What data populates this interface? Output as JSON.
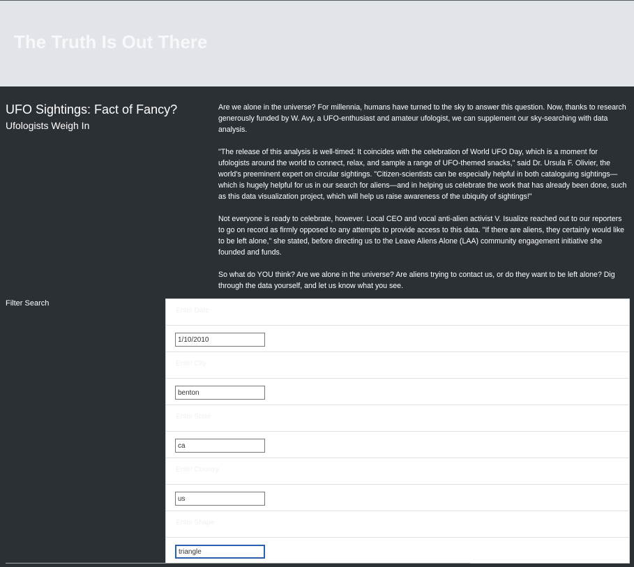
{
  "header": {
    "title": "The Truth Is Out There"
  },
  "intro": {
    "title": "UFO Sightings: Fact of Fancy?",
    "subtitle": "Ufologists Weigh In"
  },
  "article": {
    "paragraphs": [
      "Are we alone in the universe? For millennia, humans have turned to the sky to answer this question. Now, thanks to research generously funded by W. Avy, a UFO-enthusiast and amateur ufologist, we can supplement our sky-searching with data analysis.",
      "\"The release of this analysis is well-timed: It coincides with the celebration of World UFO Day, which is a moment for ufologists around the world to connect, relax, and sample a range of UFO-themed snacks,\" said Dr. Ursula F. Olivier, the world's preeminent expert on circular sightings. \"Citizen-scientists can be especially helpful in both cataloguing sightings—which is hugely helpful for us in our search for aliens—and in helping us celebrate the work that has already been done, such as this data visualization project, which will help us raise awareness of the ubiquity of sightings!\"",
      "Not everyone is ready to celebrate, however. Local CEO and vocal anti-alien activist V. Isualize reached out to our reporters to go on record as firmly opposed to any attempts to provide access to this data. \"If there are aliens, they certainly would like to be left alone,\" she stated, before directing us to the Leave Aliens Alone (LAA) community engagement initiative she founded and funds.",
      "So what do YOU think? Are we alone in the universe? Are aliens trying to contact us, or do they want to be left alone? Dig through the data yourself, and let us know what you see."
    ]
  },
  "filters": {
    "label": "Filter Search",
    "date": {
      "label": "Enter Date",
      "value": "1/10/2010"
    },
    "city": {
      "label": "Enter City",
      "value": "benton"
    },
    "state": {
      "label": "Enter State",
      "value": "ca"
    },
    "country": {
      "label": "Enter Country",
      "value": "us"
    },
    "shape": {
      "label": "Enter Shape",
      "value": "triangle"
    }
  }
}
